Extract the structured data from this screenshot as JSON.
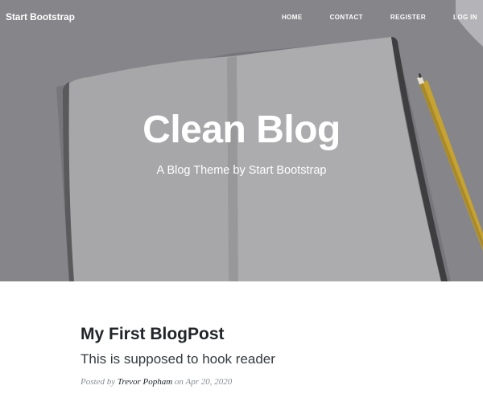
{
  "navbar": {
    "brand": "Start Bootstrap",
    "links": [
      {
        "label": "Home"
      },
      {
        "label": "Contact"
      },
      {
        "label": "Register"
      },
      {
        "label": "Log in"
      }
    ]
  },
  "masthead": {
    "title": "Clean Blog",
    "subtitle": "A Blog Theme by Start Bootstrap"
  },
  "post": {
    "title": "My First BlogPost",
    "subtitle": "This is supposed to hook reader",
    "meta_prefix": "Posted by",
    "author": "Trevor Popham",
    "meta_on": "on",
    "date": "Apr 20, 2020"
  },
  "colors": {
    "overlay": "#85858a",
    "text_dark": "#212529",
    "meta": "#868e96"
  }
}
